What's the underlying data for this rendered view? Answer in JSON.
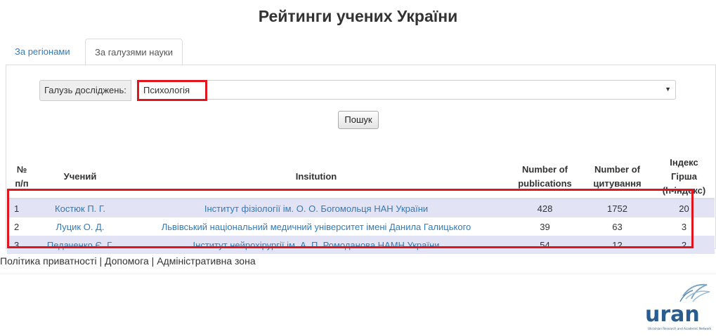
{
  "page": {
    "title": "Рейтинги учених України"
  },
  "tabs": [
    {
      "label": "За регіонами"
    },
    {
      "label": "За галузями науки"
    }
  ],
  "filter": {
    "label": "Галузь досліджень:",
    "selected": "Психологія",
    "search_button": "Пошук"
  },
  "table": {
    "headers": {
      "num": [
        "№",
        "п/п"
      ],
      "scientist": "Учений",
      "institution": "Insitution",
      "publications": [
        "Number of",
        "publications"
      ],
      "citations": [
        "Number of",
        "цитування"
      ],
      "hindex": [
        "Індекс Гірша",
        "(h-індекс)"
      ]
    },
    "rows": [
      {
        "n": "1",
        "name": "Костюк П. Г.",
        "institution": "Інститут фізіології ім. О. О. Богомольця НАН України",
        "publications": "428",
        "citations": "1752",
        "hindex": "20"
      },
      {
        "n": "2",
        "name": "Луцик О. Д.",
        "institution": "Львівський національний медичний університет імені Данила Галицького",
        "publications": "39",
        "citations": "63",
        "hindex": "3"
      },
      {
        "n": "3",
        "name": "Педаченко Є. Г.",
        "institution": "Інститут нейрохірургії ім. А. П. Ромоданова НАМН України",
        "publications": "54",
        "citations": "12",
        "hindex": "2"
      }
    ]
  },
  "footer": {
    "privacy": "Політика приватності",
    "help": "Допомога",
    "admin": "Адміністративна зона",
    "separator": " | "
  },
  "logo": {
    "text": "uran",
    "tagline": "Ukrainian Research and Academic Network"
  },
  "colors": {
    "link": "#337ab7",
    "highlight": "#e0161e",
    "row_stripe": "#e3e3f6"
  }
}
